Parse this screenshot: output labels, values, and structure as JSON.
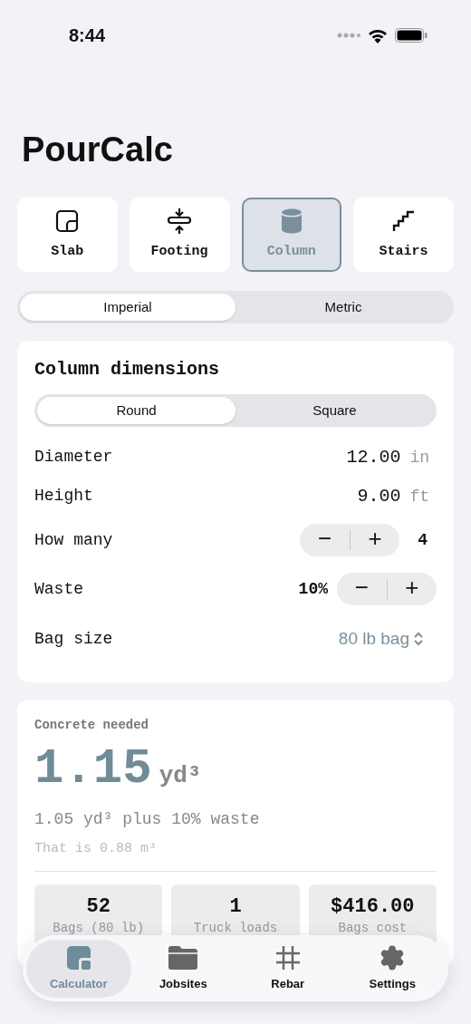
{
  "status_bar": {
    "time": "8:44"
  },
  "title": "PourCalc",
  "shapes": [
    {
      "label": "Slab",
      "kind": "slab",
      "selected": false
    },
    {
      "label": "Footing",
      "kind": "footing",
      "selected": false
    },
    {
      "label": "Column",
      "kind": "column",
      "selected": true
    },
    {
      "label": "Stairs",
      "kind": "stairs",
      "selected": false
    }
  ],
  "units": [
    {
      "label": "Imperial",
      "selected": true
    },
    {
      "label": "Metric",
      "selected": false
    }
  ],
  "dimensions": {
    "title": "Column dimensions",
    "profile": [
      {
        "label": "Round",
        "selected": true
      },
      {
        "label": "Square",
        "selected": false
      }
    ],
    "rows": [
      {
        "kind": "value",
        "label": "Diameter",
        "value": "12.00",
        "unit": "in"
      },
      {
        "kind": "value",
        "label": "Height",
        "value": "9.00",
        "unit": "ft"
      },
      {
        "kind": "stepper_after",
        "label": "How many",
        "value": "4",
        "minus": "−",
        "plus": "+"
      },
      {
        "kind": "stepper_before",
        "label": "Waste",
        "value": "10%",
        "minus": "−",
        "plus": "+"
      },
      {
        "kind": "picker",
        "label": "Bag size",
        "value": "80 lb bag"
      }
    ]
  },
  "result": {
    "heading": "Concrete needed",
    "amount": "1.15",
    "unit": "yd³",
    "detail": "1.05 yd³ plus 10% waste",
    "metric": "That is 0.88 m³",
    "stats": [
      {
        "value": "52",
        "label": "Bags (80 lb)"
      },
      {
        "value": "1",
        "label": "Truck loads"
      },
      {
        "value": "$416.00",
        "label": "Bags cost"
      }
    ]
  },
  "tab_bar": [
    {
      "label": "Calculator",
      "kind": "calculator",
      "selected": true
    },
    {
      "label": "Jobsites",
      "kind": "folder",
      "selected": false
    },
    {
      "label": "Rebar",
      "kind": "hash",
      "selected": false
    },
    {
      "label": "Settings",
      "kind": "gear",
      "selected": false
    }
  ]
}
